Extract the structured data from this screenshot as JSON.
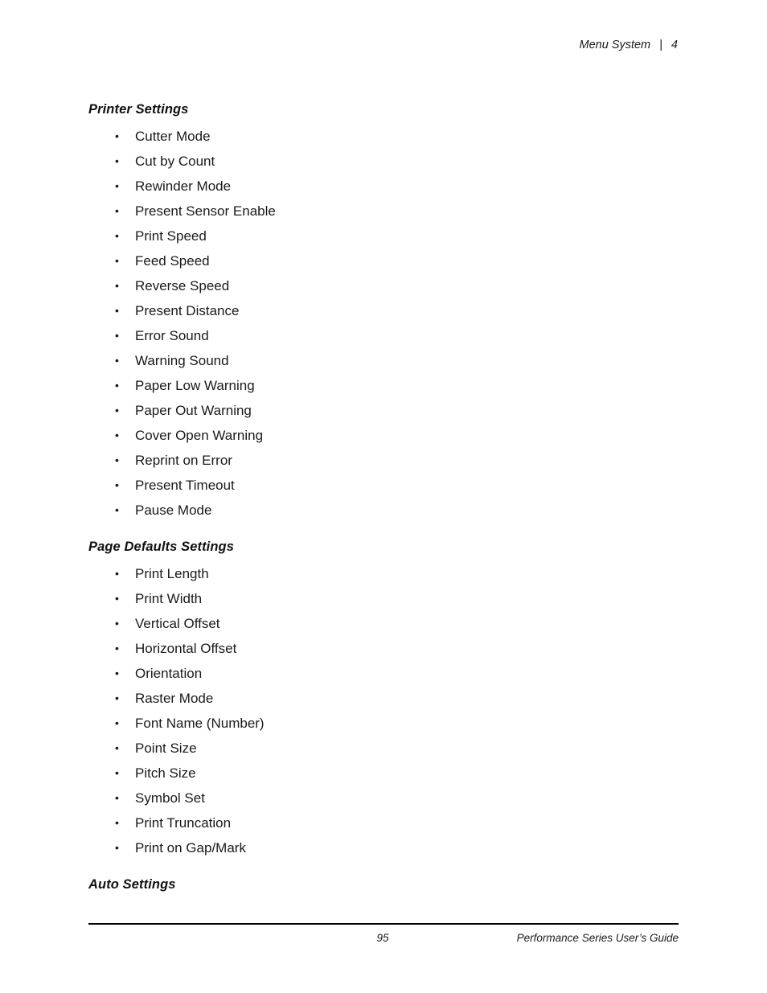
{
  "header": {
    "chapter_title": "Menu System",
    "separator": "|",
    "chapter_number": "4"
  },
  "bullet_glyph": "•",
  "sections": [
    {
      "heading": "Printer Settings",
      "items": [
        "Cutter Mode",
        "Cut by Count",
        "Rewinder Mode",
        "Present Sensor Enable",
        "Print Speed",
        "Feed Speed",
        "Reverse Speed",
        "Present Distance",
        "Error Sound",
        "Warning Sound",
        "Paper Low Warning",
        "Paper Out Warning",
        "Cover Open Warning",
        "Reprint on Error",
        "Present Timeout",
        "Pause Mode"
      ]
    },
    {
      "heading": "Page Defaults Settings",
      "items": [
        "Print Length",
        "Print Width",
        "Vertical Offset",
        "Horizontal Offset",
        "Orientation",
        "Raster Mode",
        "Font Name (Number)",
        "Point Size",
        "Pitch Size",
        "Symbol Set",
        "Print Truncation",
        "Print on Gap/Mark"
      ]
    },
    {
      "heading": "Auto Settings",
      "items": []
    }
  ],
  "footer": {
    "page_number": "95",
    "guide_title": "Performance Series User’s Guide"
  }
}
